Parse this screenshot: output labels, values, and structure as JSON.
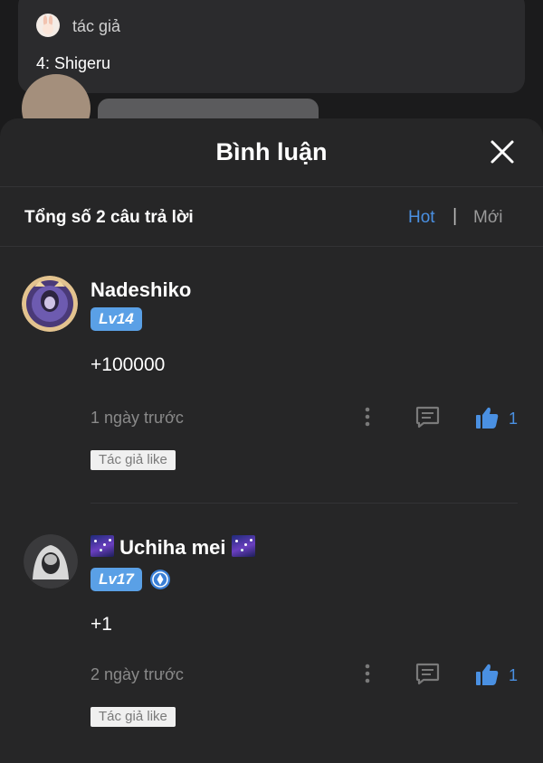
{
  "background": {
    "author_label": "tác giả",
    "author_text": "4: Shigeru"
  },
  "sheet": {
    "title": "Bình luận",
    "total_label": "Tổng số 2 câu trả lời",
    "sort": {
      "hot": "Hot",
      "separator": "|",
      "new": "Mới",
      "active": "Hot"
    }
  },
  "comments": [
    {
      "name": "Nadeshiko",
      "level": "Lv14",
      "text": "+100000",
      "time": "1 ngày trước",
      "likes": "1",
      "author_like": "Tác giả like"
    },
    {
      "name": "Uchiha mei",
      "level": "Lv17",
      "text": "+1",
      "time": "2 ngày trước",
      "likes": "1",
      "author_like": "Tác giả like"
    }
  ],
  "colors": {
    "accent": "#4a90e2",
    "level_badge": "#5aa0e6",
    "sheet_bg": "#262627"
  }
}
